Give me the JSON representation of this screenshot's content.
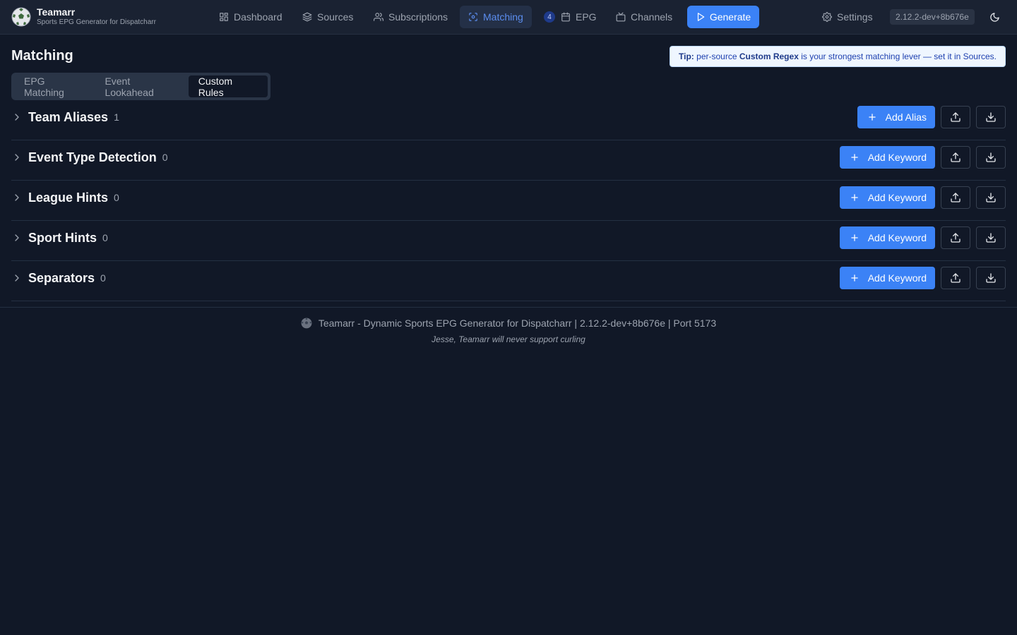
{
  "app": {
    "title": "Teamarr",
    "subtitle": "Sports EPG Generator for Dispatcharr",
    "version": "2.12.2-dev+8b676e"
  },
  "nav": {
    "dashboard": "Dashboard",
    "sources": "Sources",
    "subscriptions": "Subscriptions",
    "matching": "Matching",
    "epg_badge": "4",
    "epg": "EPG",
    "channels": "Channels",
    "generate": "Generate",
    "settings": "Settings"
  },
  "page": {
    "title": "Matching",
    "tip_label": "Tip:",
    "tip_pre": " per-source ",
    "tip_bold": "Custom Regex",
    "tip_post": " is your strongest matching lever — set it in Sources."
  },
  "tabs": [
    "EPG Matching",
    "Event Lookahead",
    "Custom Rules"
  ],
  "active_tab": "Custom Rules",
  "sections": [
    {
      "title": "Team Aliases",
      "count": "1",
      "add_label": "Add Alias"
    },
    {
      "title": "Event Type Detection",
      "count": "0",
      "add_label": "Add Keyword"
    },
    {
      "title": "League Hints",
      "count": "0",
      "add_label": "Add Keyword"
    },
    {
      "title": "Sport Hints",
      "count": "0",
      "add_label": "Add Keyword"
    },
    {
      "title": "Separators",
      "count": "0",
      "add_label": "Add Keyword"
    }
  ],
  "footer": {
    "text": "Teamarr - Dynamic Sports EPG Generator for Dispatcharr | 2.12.2-dev+8b676e | Port 5173",
    "quote": "Jesse, Teamarr will never support curling"
  },
  "colors": {
    "background": "#111827",
    "topbar": "#1a2232",
    "accent": "#3b82f6",
    "active_nav_text": "#5b8def",
    "tip_bg": "#eff6ff"
  },
  "icons": {
    "logo": "soccer-ball-icon",
    "dashboard": "layout-grid-icon",
    "sources": "layers-icon",
    "subscriptions": "users-icon",
    "matching": "scan-icon",
    "epg": "calendar-icon",
    "channels": "tv-icon",
    "generate": "play-icon",
    "settings": "gear-icon",
    "theme": "moon-icon",
    "expand": "chevron-right-icon",
    "add": "plus-icon",
    "import": "upload-icon",
    "export": "download-icon"
  }
}
